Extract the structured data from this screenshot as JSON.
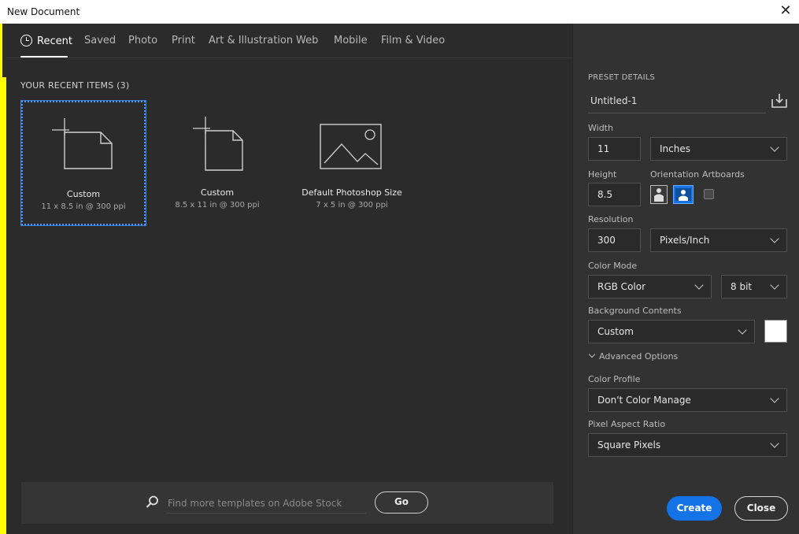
{
  "window": {
    "title": "New Document"
  },
  "tabs": [
    "Recent",
    "Saved",
    "Photo",
    "Print",
    "Art & Illustration",
    "Web",
    "Mobile",
    "Film & Video"
  ],
  "recent": {
    "label": "YOUR RECENT ITEMS",
    "count": "(3)",
    "items": [
      {
        "name": "Custom",
        "desc": "11 x 8.5 in @ 300 ppi"
      },
      {
        "name": "Custom",
        "desc": "8.5 x 11 in @ 300 ppi"
      },
      {
        "name": "Default Photoshop Size",
        "desc": "7 x 5 in @ 300 ppi"
      }
    ]
  },
  "search": {
    "placeholder": "Find more templates on Adobe Stock",
    "button": "Go"
  },
  "preset": {
    "header": "PRESET DETAILS",
    "name": "Untitled-1",
    "width_label": "Width",
    "width_value": "11",
    "width_unit": "Inches",
    "height_label": "Height",
    "height_value": "8.5",
    "orientation_label": "Orientation",
    "artboards_label": "Artboards",
    "resolution_label": "Resolution",
    "resolution_value": "300",
    "resolution_unit": "Pixels/Inch",
    "color_mode_label": "Color Mode",
    "color_mode": "RGB Color",
    "bit_depth": "8 bit",
    "background_label": "Background Contents",
    "background": "Custom",
    "background_color": "#ffffff",
    "advanced_label": "Advanced Options",
    "profile_label": "Color Profile",
    "profile": "Don't Color Manage",
    "aspect_label": "Pixel Aspect Ratio",
    "aspect": "Square Pixels"
  },
  "actions": {
    "create": "Create",
    "close": "Close"
  },
  "colors": {
    "accent": "#1473e6",
    "selection": "#4e9bff"
  }
}
